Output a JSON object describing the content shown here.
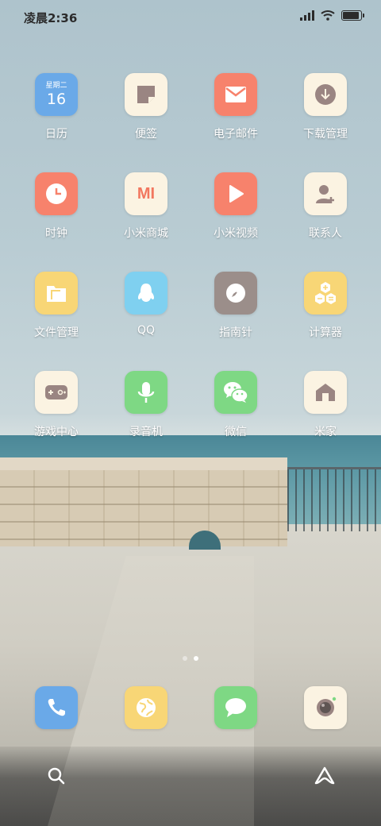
{
  "status_bar": {
    "time": "凌晨2:36",
    "icons": [
      "signal-icon",
      "wifi-icon",
      "battery-icon"
    ],
    "battery_level": 0.9
  },
  "apps": [
    {
      "label": "日历",
      "icon": "calendar-icon",
      "bg": "#6aa9e8",
      "weekday": "星期二",
      "day": "16"
    },
    {
      "label": "便签",
      "icon": "notes-icon",
      "bg": "#fbf3e2"
    },
    {
      "label": "电子邮件",
      "icon": "mail-icon",
      "bg": "#f7826c"
    },
    {
      "label": "下载管理",
      "icon": "download-icon",
      "bg": "#fbf3e2"
    },
    {
      "label": "时钟",
      "icon": "clock-icon",
      "bg": "#f7826c"
    },
    {
      "label": "小米商城",
      "icon": "mi-store-icon",
      "bg": "#fbf3e2",
      "badge_text": "MI"
    },
    {
      "label": "小米视频",
      "icon": "video-play-icon",
      "bg": "#f7826c"
    },
    {
      "label": "联系人",
      "icon": "contacts-icon",
      "bg": "#fbf3e2"
    },
    {
      "label": "文件管理",
      "icon": "folder-icon",
      "bg": "#f8d676"
    },
    {
      "label": "QQ",
      "icon": "qq-penguin-icon",
      "bg": "#7fd0f0"
    },
    {
      "label": "指南针",
      "icon": "compass-icon",
      "bg": "#9b8e8a"
    },
    {
      "label": "计算器",
      "icon": "calculator-icon",
      "bg": "#f8d676"
    },
    {
      "label": "游戏中心",
      "icon": "gamepad-icon",
      "bg": "#fbf3e2"
    },
    {
      "label": "录音机",
      "icon": "microphone-icon",
      "bg": "#7ed884"
    },
    {
      "label": "微信",
      "icon": "wechat-icon",
      "bg": "#7ed884"
    },
    {
      "label": "米家",
      "icon": "home-icon",
      "bg": "#fbf3e2"
    }
  ],
  "page_indicator": {
    "count": 2,
    "active": 1
  },
  "dock": [
    {
      "icon": "phone-icon",
      "bg": "#6aa9e8"
    },
    {
      "icon": "browser-globe-icon",
      "bg": "#f8d676"
    },
    {
      "icon": "message-icon",
      "bg": "#7ed884"
    },
    {
      "icon": "camera-icon",
      "bg": "#fbf3e2"
    }
  ],
  "bottom_bar": {
    "left": "search-icon",
    "right": "assistant-icon"
  }
}
